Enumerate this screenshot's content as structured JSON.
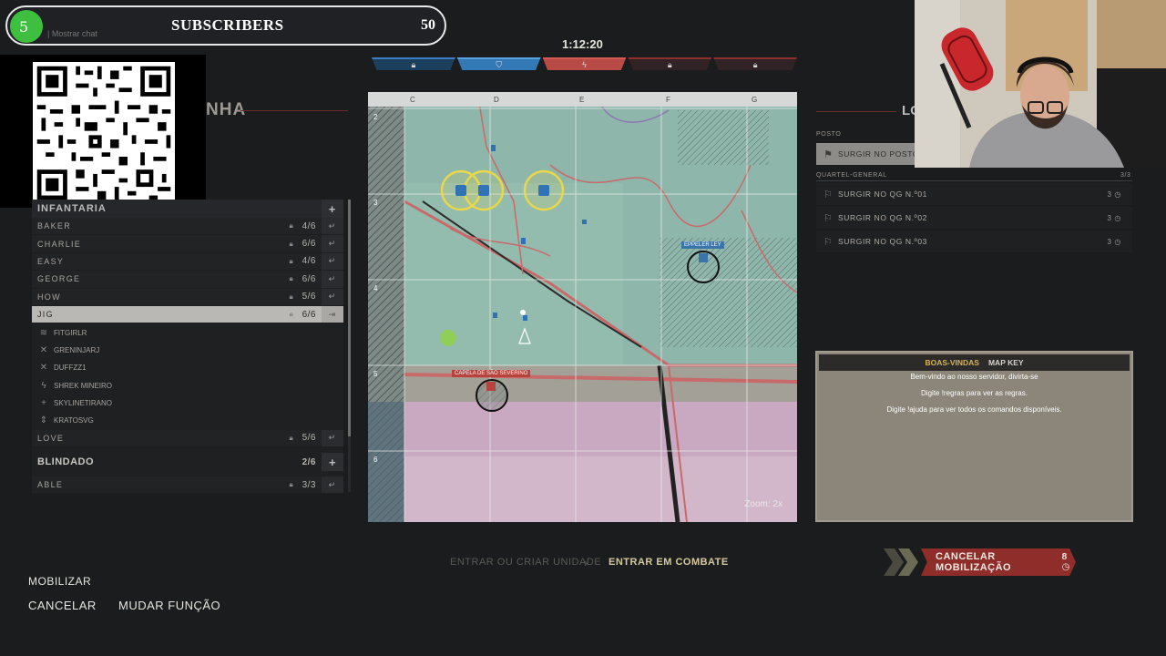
{
  "overlay": {
    "sub_level": "5",
    "show_chat": "| Mostrar chat",
    "sub_title": "SUBSCRIBERS",
    "sub_count": "50"
  },
  "header": {
    "timer": "1:12:20",
    "panel_title": "NHA",
    "segments": [
      {
        "icon": "lock",
        "style": "blue"
      },
      {
        "icon": "shield",
        "style": "blue-active"
      },
      {
        "icon": "bolt",
        "style": "red-active"
      },
      {
        "icon": "lock",
        "style": "dark"
      },
      {
        "icon": "lock",
        "style": "dark"
      }
    ]
  },
  "units": {
    "infantry_header": "INFANTARIA",
    "add_label": "+",
    "rows": [
      {
        "name": "BAKER",
        "count": "4/6"
      },
      {
        "name": "CHARLIE",
        "count": "6/6"
      },
      {
        "name": "EASY",
        "count": "4/6"
      },
      {
        "name": "GEORGE",
        "count": "6/6"
      },
      {
        "name": "HOW",
        "count": "5/6"
      }
    ],
    "selected": {
      "name": "JIG",
      "count": "6/6"
    },
    "members": [
      {
        "icon": "chevrons-icon",
        "glyph": "≋",
        "name": "FITGIRLR"
      },
      {
        "icon": "crossed-swords-icon",
        "glyph": "✕",
        "name": "GRENINJARJ"
      },
      {
        "icon": "crossed-rifles-icon",
        "glyph": "✕",
        "name": "DUFFZZ1"
      },
      {
        "icon": "bolt-icon",
        "glyph": "ϟ",
        "name": "SHREK MINEIRO"
      },
      {
        "icon": "medic-cross-icon",
        "glyph": "+",
        "name": "SKYLINETIRANO"
      },
      {
        "icon": "support-icon",
        "glyph": "⇕",
        "name": "KRATOSVG"
      }
    ],
    "love": {
      "name": "LOVE",
      "count": "5/6"
    },
    "armor_header": "BLINDADO",
    "armor_count": "2/6",
    "able": {
      "name": "ABLE",
      "count": "3/3"
    }
  },
  "map": {
    "columns": [
      "C",
      "D",
      "E",
      "F",
      "G"
    ],
    "rows": [
      "2",
      "3",
      "4",
      "5",
      "6"
    ],
    "label_ey": "EPPELER LEY",
    "label_chapel": "CAPELA DE SÃO SEVERINO",
    "zoom": "Zoom: 2x"
  },
  "spawn": {
    "title": "LO",
    "post_label": "POSTO",
    "post_option": "SURGIR NO POSTO",
    "hq_label": "QUARTEL-GENERAL",
    "hq_count": "3/3",
    "hq_options": [
      {
        "label": "SURGIR NO QG N.º01",
        "value": "3"
      },
      {
        "label": "SURGIR NO QG N.º02",
        "value": "3"
      },
      {
        "label": "SURGIR NO QG N.º03",
        "value": "3"
      }
    ]
  },
  "chat": {
    "tab_welcome": "BOAS-VINDAS",
    "tab_mapkey": "MAP KEY",
    "lines": [
      "Bem-vindo ao nosso servidor, divirta-se",
      "Digite !regras para ver as regras.",
      "Digite !ajuda para ver todos os comandos disponíveis."
    ]
  },
  "footer": {
    "step_create": "ENTRAR OU CRIAR UNIDADE",
    "step_combat": "ENTRAR EM COMBATE",
    "cancel_mobilization": "CANCELAR MOBILIZAÇÃO",
    "cancel_mobilization_count": "8",
    "mobilize": "MOBILIZAR",
    "cancel": "CANCELAR",
    "change_role": "MUDAR FUNÇÃO"
  },
  "colors": {
    "accent_red": "#8e2d29",
    "accent_gold": "#d7c89e",
    "team_blue": "#3379b5"
  }
}
